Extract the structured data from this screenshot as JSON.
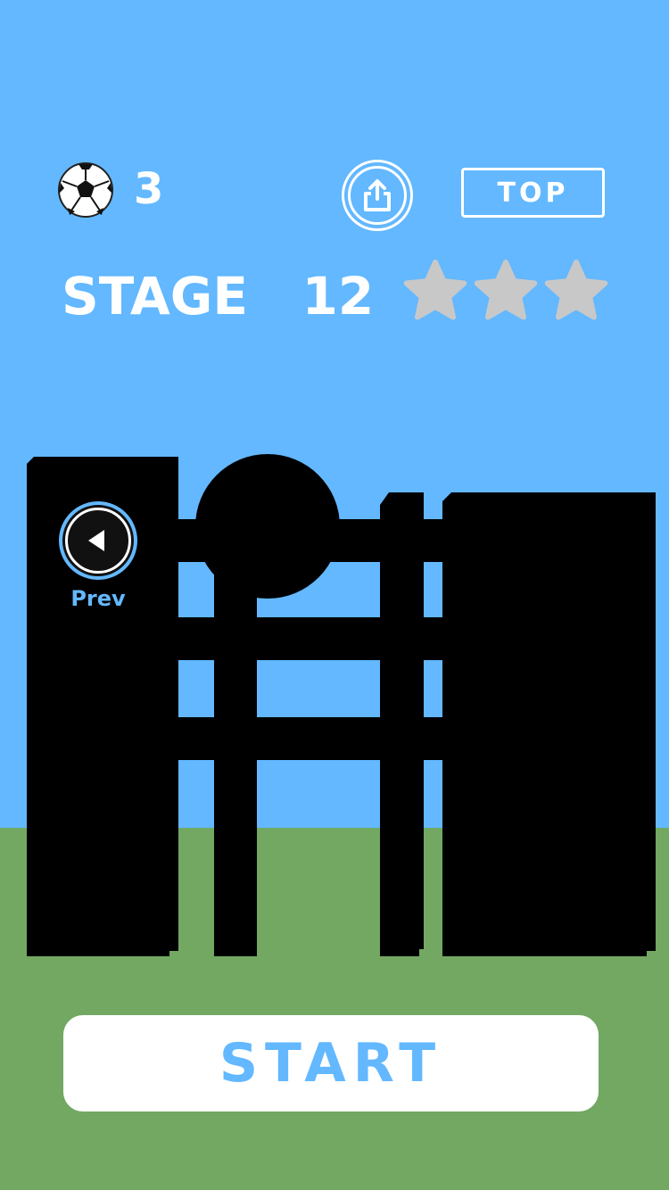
{
  "hud": {
    "ball_icon": "soccer-ball-icon",
    "ball_count": "3",
    "share_icon": "share-icon",
    "top_label": "TOP"
  },
  "stage": {
    "title": "STAGE   12",
    "stars_earned": 0,
    "stars_total": 3
  },
  "controls": {
    "prev_label": "Prev",
    "start_label": "START"
  },
  "colors": {
    "sky": "#63b8ff",
    "grass": "#72a862",
    "silhouette": "#000000",
    "star_empty": "#c8c8c8",
    "accent": "#63b8ff"
  }
}
